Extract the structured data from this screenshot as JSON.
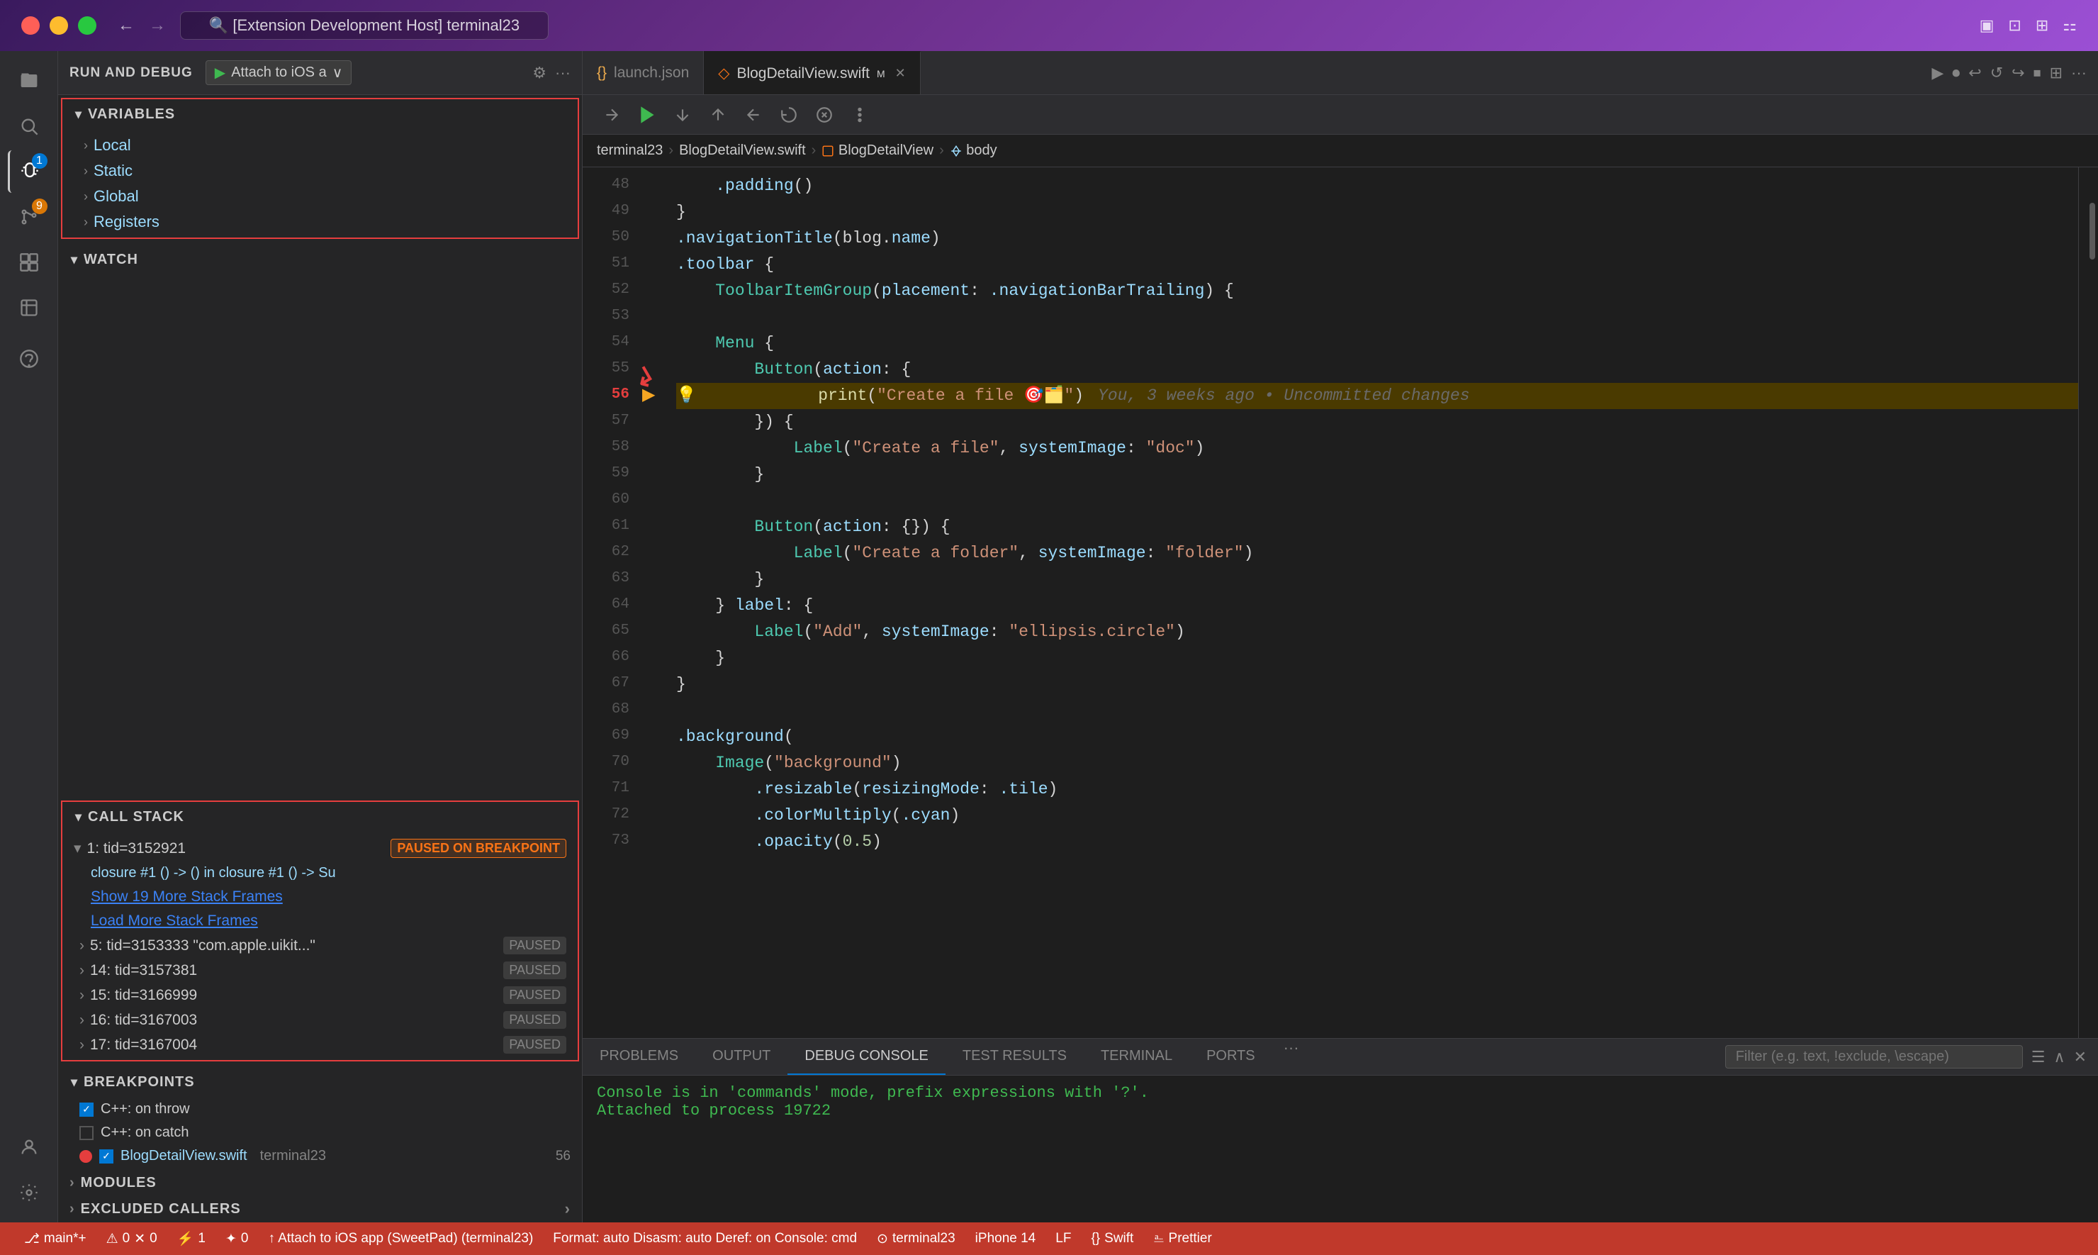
{
  "titlebar": {
    "search_text": "🔍 [Extension Development Host] terminal23",
    "nav_back": "←",
    "nav_forward": "→"
  },
  "debug_toolbar": {
    "title": "RUN AND DEBUG",
    "config": "Attach to iOS a",
    "play_icon": "▶",
    "settings_icon": "⚙",
    "more_icon": "···"
  },
  "variables": {
    "title": "VARIABLES",
    "items": [
      {
        "label": "Local",
        "type": "expandable"
      },
      {
        "label": "Static",
        "type": "expandable"
      },
      {
        "label": "Global",
        "type": "expandable"
      },
      {
        "label": "Registers",
        "type": "expandable"
      }
    ]
  },
  "watch": {
    "title": "WATCH"
  },
  "callstack": {
    "title": "CALL STACK",
    "threads": [
      {
        "id": "1: tid=3152921",
        "status": "PAUSED ON BREAKPOINT",
        "frame": "closure #1 () -> () in closure #1 () -> Su"
      }
    ],
    "links": [
      "Show 19 More Stack Frames",
      "Load More Stack Frames"
    ],
    "other_threads": [
      {
        "id": "5: tid=3153333",
        "name": "\"com.apple.uikit...\"",
        "status": "PAUSED"
      },
      {
        "id": "14: tid=3157381",
        "status": "PAUSED"
      },
      {
        "id": "15: tid=3166999",
        "status": "PAUSED"
      },
      {
        "id": "16: tid=3167003",
        "status": "PAUSED"
      },
      {
        "id": "17: tid=3167004",
        "status": "PAUSED"
      }
    ]
  },
  "breakpoints": {
    "title": "BREAKPOINTS",
    "items": [
      {
        "label": "C++: on throw",
        "checked": true
      },
      {
        "label": "C++: on catch",
        "checked": false
      },
      {
        "label": "BlogDetailView.swift",
        "terminal": "terminal23",
        "line": "56",
        "has_dot": true,
        "checked": true
      }
    ]
  },
  "modules": {
    "title": "MODULES"
  },
  "excluded_callers": {
    "title": "EXCLUDED CALLERS"
  },
  "tabs": [
    {
      "label": "launch.json",
      "icon": "json",
      "active": false
    },
    {
      "label": "BlogDetailView.swift",
      "icon": "swift",
      "active": true,
      "modified": true
    }
  ],
  "breadcrumb": {
    "parts": [
      "terminal23",
      ">",
      "BlogDetailView.swift",
      ">",
      "BlogDetailView",
      ">",
      "body"
    ]
  },
  "debug_controls": {
    "buttons": [
      "▶",
      "⟳",
      "↙",
      "↓",
      "↑",
      "⟲",
      "⊘",
      "⊕"
    ]
  },
  "code": {
    "lines": [
      {
        "num": 48,
        "content": "    .padding()"
      },
      {
        "num": 49,
        "content": "}"
      },
      {
        "num": 50,
        "content": ".navigationTitle(blog.name)"
      },
      {
        "num": 51,
        "content": ".toolbar {"
      },
      {
        "num": 52,
        "content": "    ToolbarItemGroup(placement: .navigationBarTrailing) {"
      },
      {
        "num": 53,
        "content": ""
      },
      {
        "num": 54,
        "content": "    Menu {"
      },
      {
        "num": 55,
        "content": "        Button(action: {"
      },
      {
        "num": 56,
        "content": "            print(\"Create a file 🎯🗂️\")",
        "highlighted": true,
        "breakpoint": true
      },
      {
        "num": 57,
        "content": "        }) {"
      },
      {
        "num": 58,
        "content": "            Label(\"Create a file\", systemImage: \"doc\")"
      },
      {
        "num": 59,
        "content": "        }"
      },
      {
        "num": 60,
        "content": ""
      },
      {
        "num": 61,
        "content": "        Button(action: {}) {"
      },
      {
        "num": 62,
        "content": "            Label(\"Create a folder\", systemImage: \"folder\")"
      },
      {
        "num": 63,
        "content": "        }"
      },
      {
        "num": 64,
        "content": "    } label: {"
      },
      {
        "num": 65,
        "content": "        Label(\"Add\", systemImage: \"ellipsis.circle\")"
      },
      {
        "num": 66,
        "content": "    }"
      },
      {
        "num": 67,
        "content": "}"
      },
      {
        "num": 68,
        "content": ""
      },
      {
        "num": 69,
        "content": ".background("
      },
      {
        "num": 70,
        "content": "    Image(\"background\")"
      },
      {
        "num": 71,
        "content": "        .resizable(resizingMode: .tile)"
      },
      {
        "num": 72,
        "content": "        .colorMultiply(.cyan)"
      },
      {
        "num": 73,
        "content": "        .opacity(0.5)"
      }
    ],
    "blame_line": 56,
    "blame_text": "You, 3 weeks ago • Uncommitted changes"
  },
  "panel": {
    "tabs": [
      "PROBLEMS",
      "OUTPUT",
      "DEBUG CONSOLE",
      "TEST RESULTS",
      "TERMINAL",
      "PORTS"
    ],
    "active_tab": "DEBUG CONSOLE",
    "filter_placeholder": "Filter (e.g. text, !exclude, \\escape)",
    "console_lines": [
      "Console is in 'commands' mode, prefix expressions with '?'.",
      "Attached to process 19722"
    ]
  },
  "status_bar": {
    "items": [
      {
        "icon": "⎇",
        "text": "main*+"
      },
      {
        "icon": "⚠",
        "text": "0"
      },
      {
        "icon": "✕",
        "text": "0"
      },
      {
        "icon": "⚡",
        "text": "1"
      },
      {
        "icon": "✦",
        "text": "0"
      },
      {
        "text": "↑ Attach to iOS app (SweetPad) (terminal23)"
      },
      {
        "text": "Format: auto  Disasm: auto  Deref: on  Console: cmd"
      },
      {
        "icon": "⊙",
        "text": "terminal23"
      },
      {
        "text": "iPhone 14"
      },
      {
        "text": "LF"
      },
      {
        "text": "{} Swift"
      },
      {
        "text": "⎁ Prettier"
      }
    ]
  }
}
